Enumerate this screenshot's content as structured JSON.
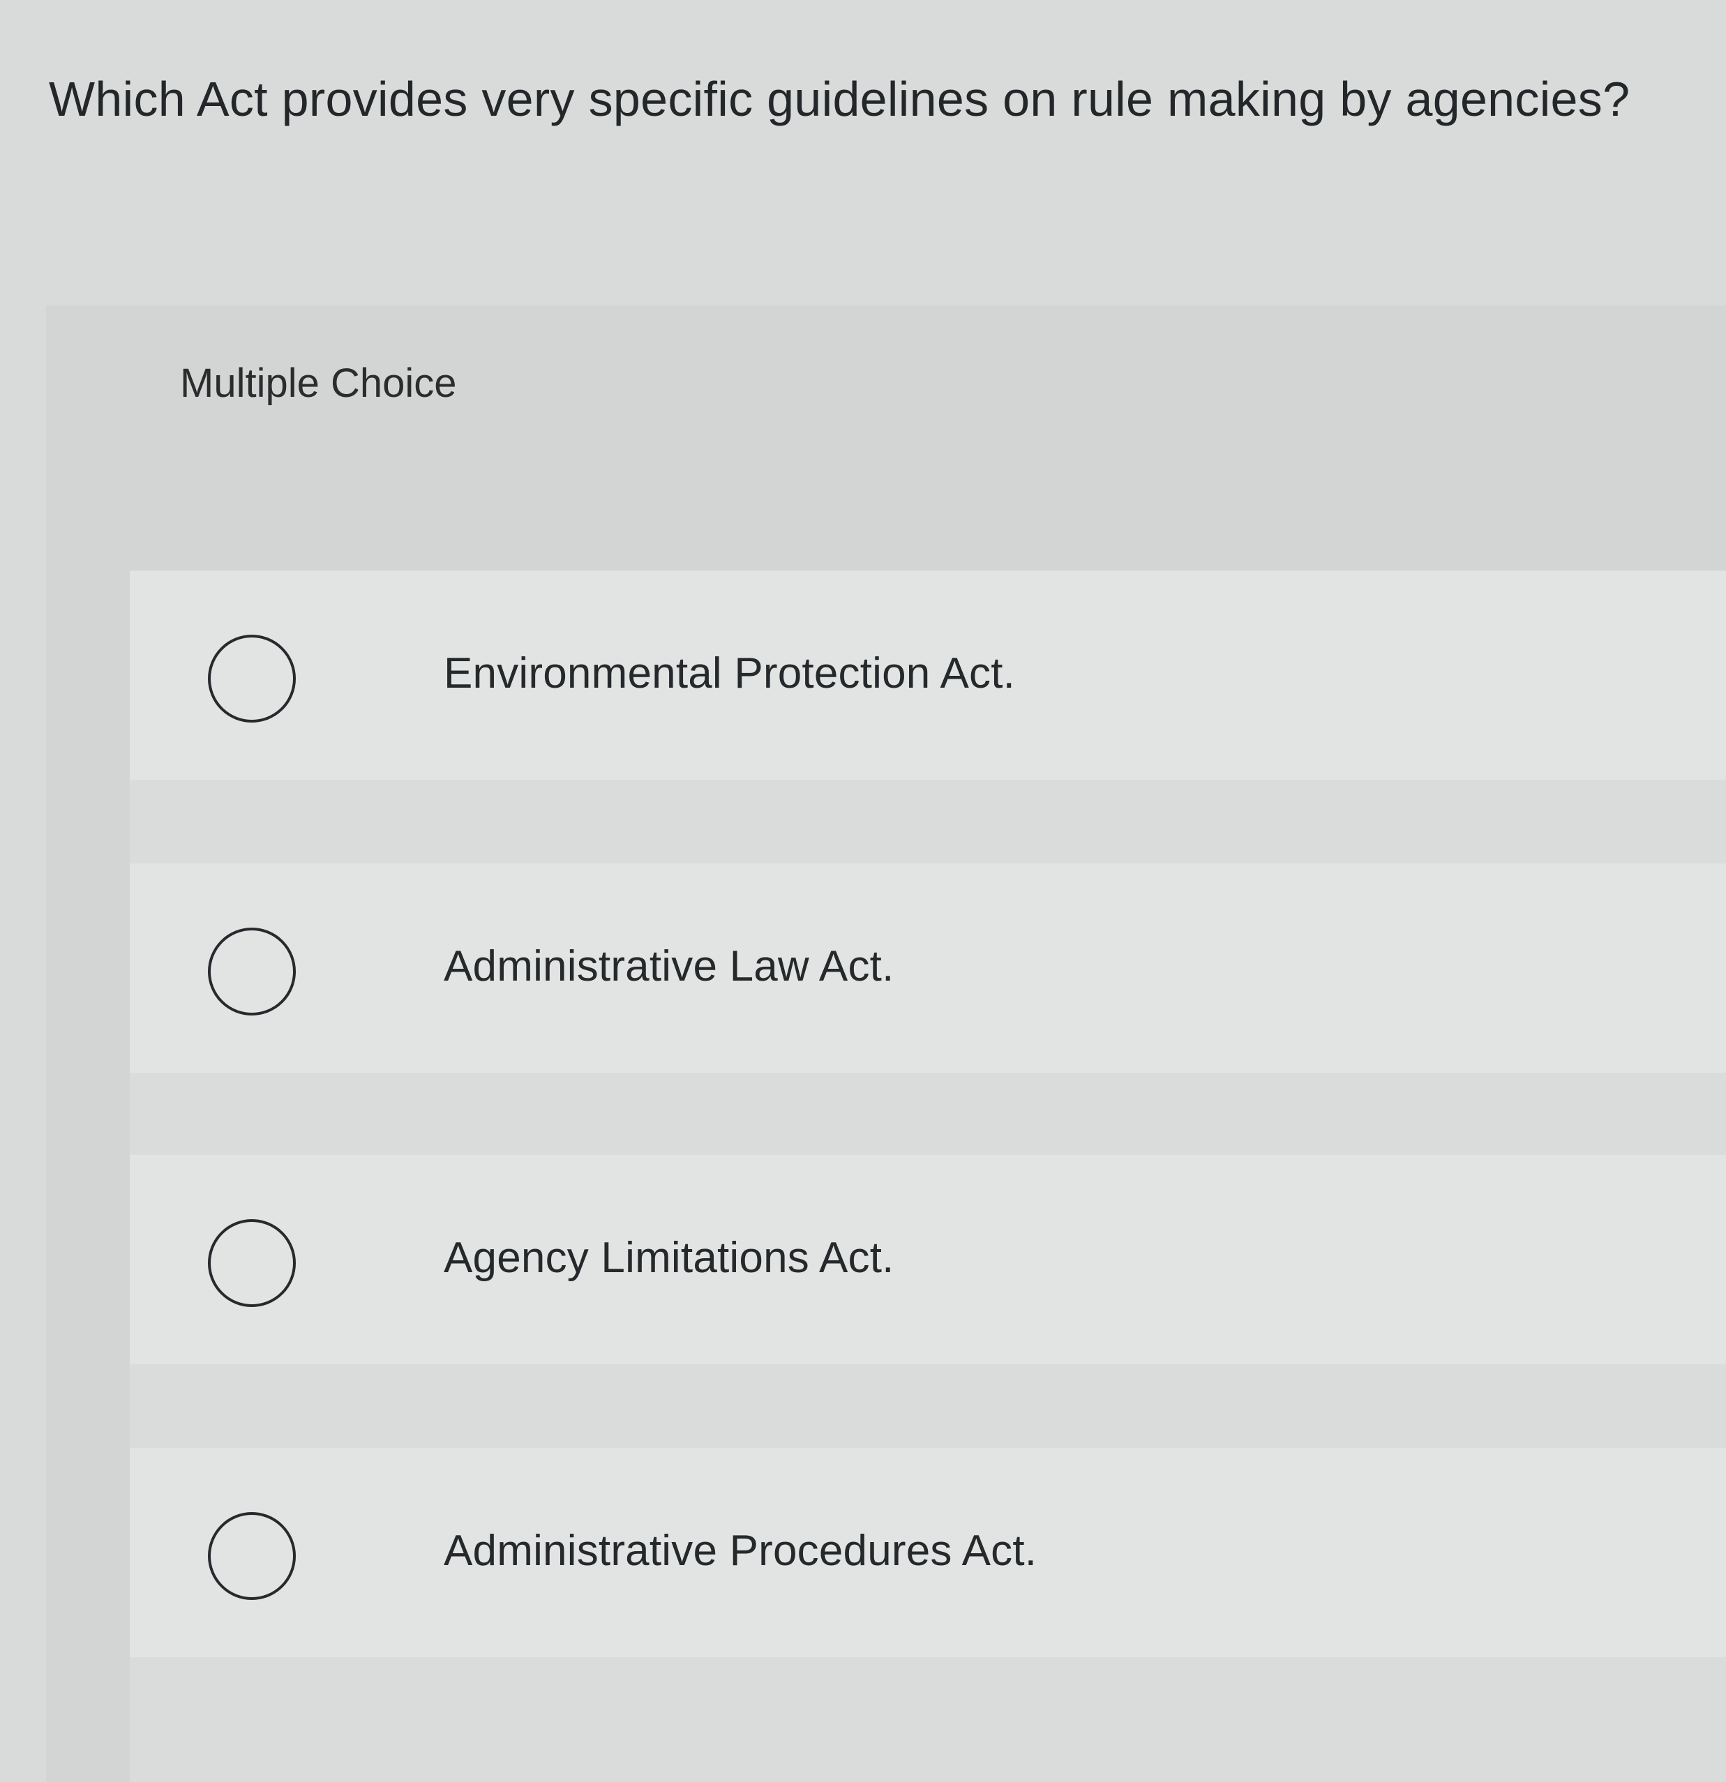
{
  "question": {
    "text": "Which Act provides very specific guidelines on rule making by agencies?"
  },
  "panel": {
    "label": "Multiple Choice"
  },
  "options": [
    {
      "label": "Environmental Protection Act.",
      "selected": false
    },
    {
      "label": "Administrative Law Act.",
      "selected": false
    },
    {
      "label": "Agency Limitations Act.",
      "selected": false
    },
    {
      "label": "Administrative Procedures Act.",
      "selected": false
    }
  ]
}
